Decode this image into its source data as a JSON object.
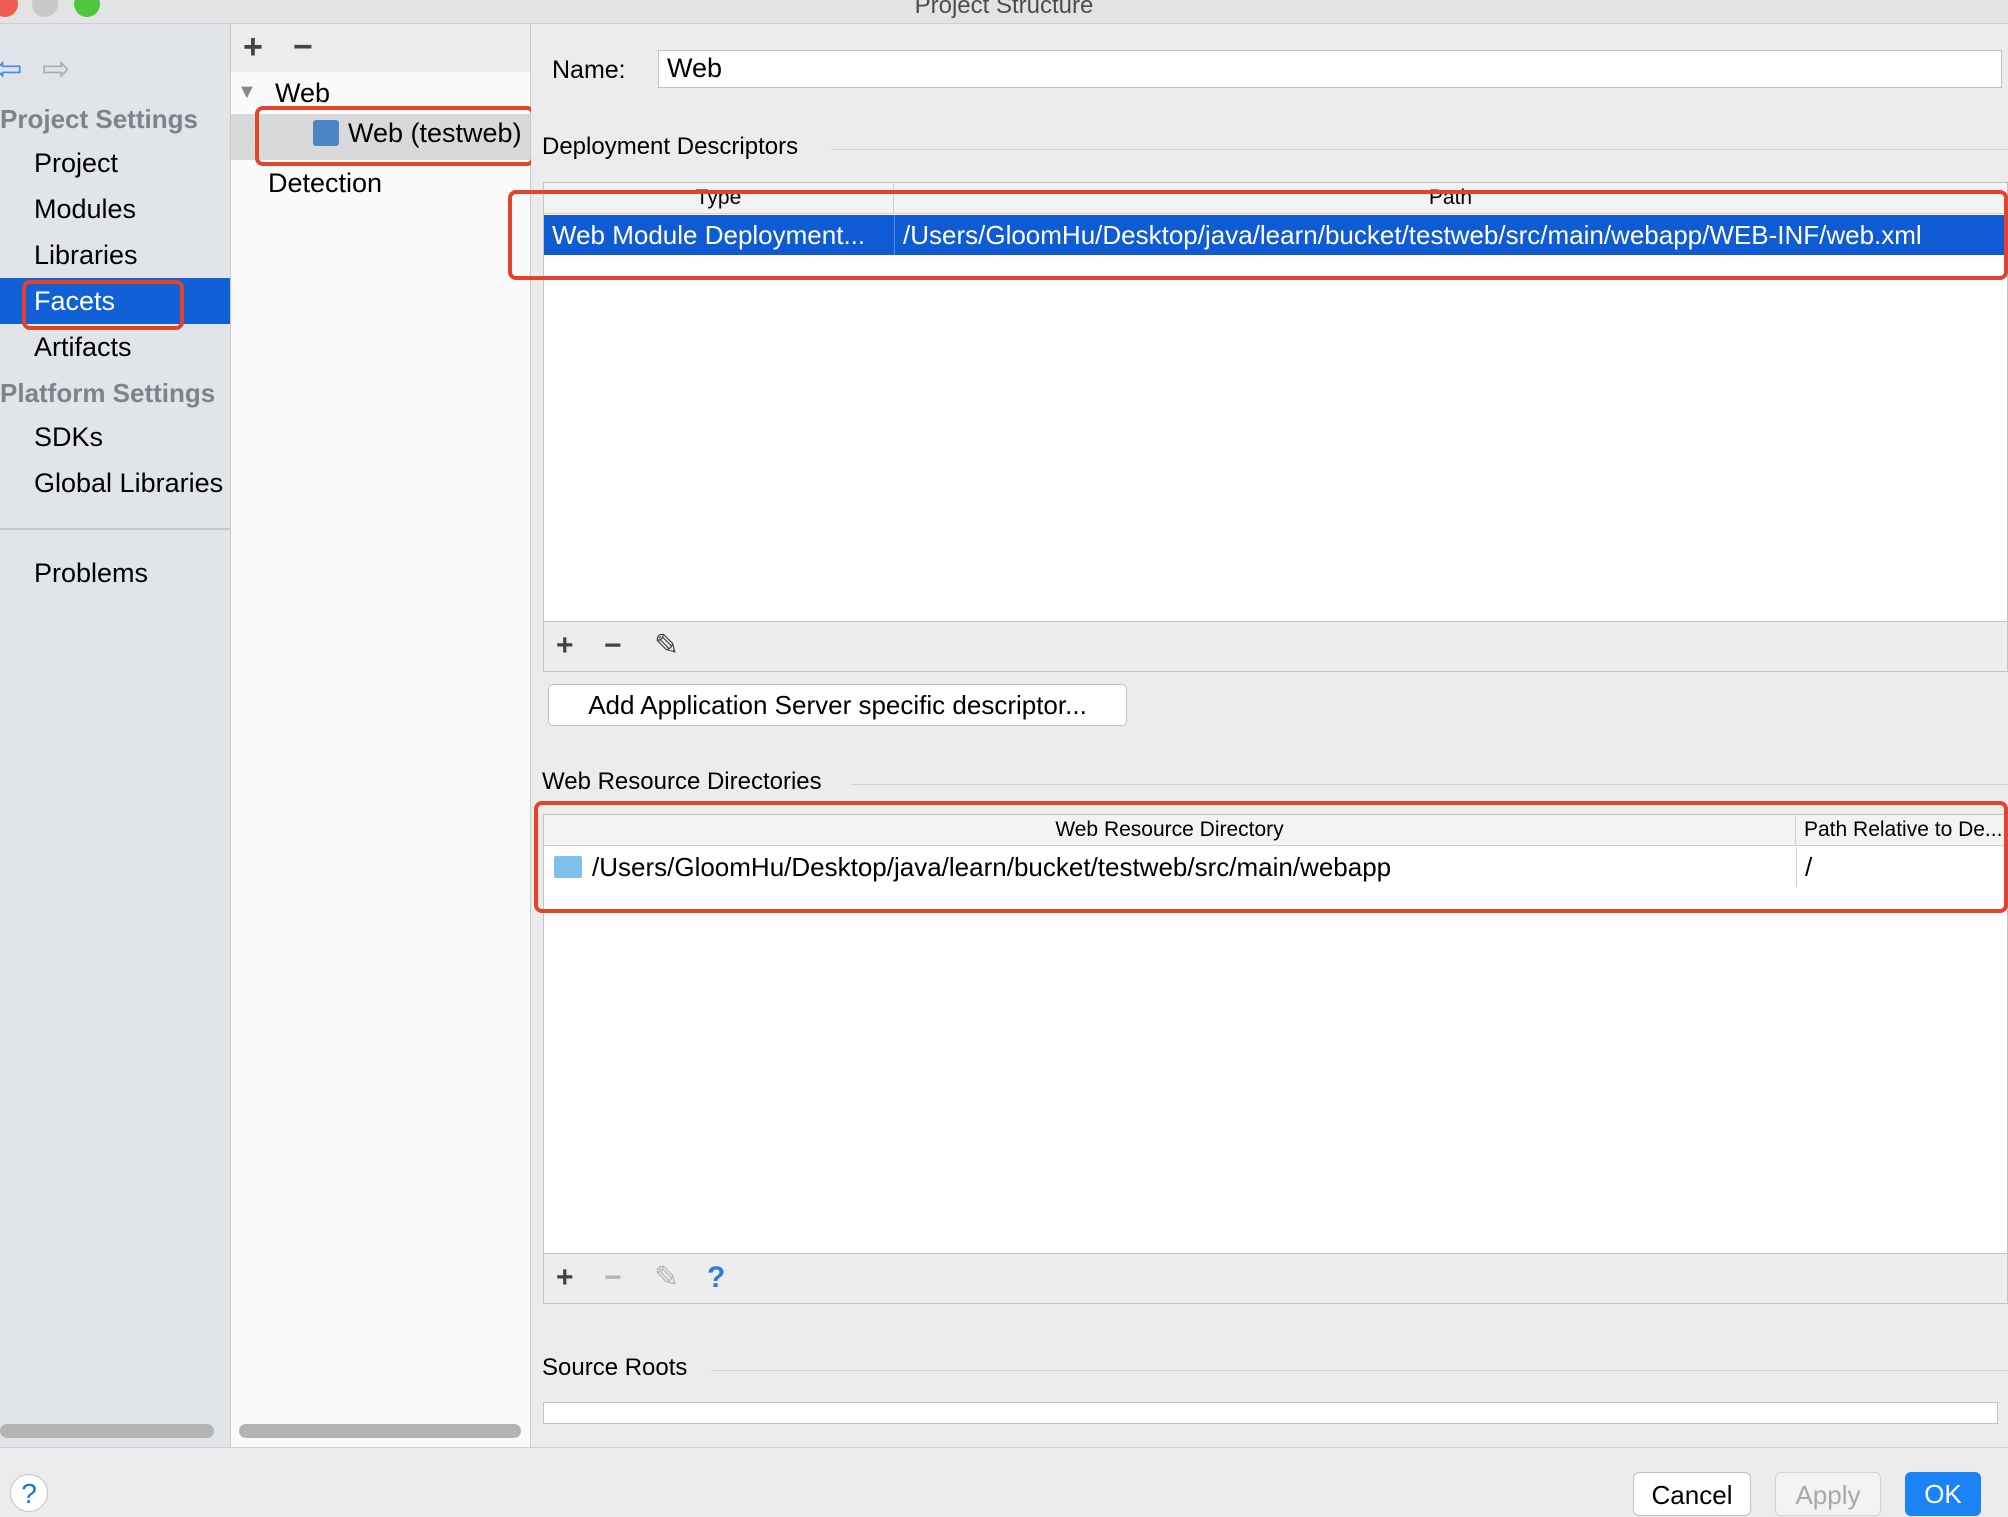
{
  "window": {
    "title": "Project Structure"
  },
  "sidebar": {
    "project_settings_label": "Project Settings",
    "project_items": [
      "Project",
      "Modules",
      "Libraries",
      "Facets",
      "Artifacts"
    ],
    "platform_settings_label": "Platform Settings",
    "platform_items": [
      "SDKs",
      "Global Libraries"
    ],
    "problems_label": "Problems",
    "selected": "Facets"
  },
  "tree": {
    "add_label": "+",
    "remove_label": "−",
    "group_label": "Web",
    "facet_label": "Web (testweb)",
    "detection_label": "Detection"
  },
  "main": {
    "name_label": "Name:",
    "name_value": "Web",
    "deployment": {
      "title": "Deployment Descriptors",
      "columns": [
        "Type",
        "Path"
      ],
      "rows": [
        {
          "type": "Web Module Deployment...",
          "path": "/Users/GloomHu/Desktop/java/learn/bucket/testweb/src/main/webapp/WEB-INF/web.xml"
        }
      ],
      "add_button": "Add Application Server specific descriptor..."
    },
    "resources": {
      "title": "Web Resource Directories",
      "columns": [
        "Web Resource Directory",
        "Path Relative to De..."
      ],
      "rows": [
        {
          "directory": "/Users/GloomHu/Desktop/java/learn/bucket/testweb/src/main/webapp",
          "relative": "/"
        }
      ],
      "help_label": "?"
    },
    "source_roots": {
      "title": "Source Roots"
    }
  },
  "footer": {
    "help": "?",
    "cancel": "Cancel",
    "apply": "Apply",
    "ok": "OK"
  },
  "colors": {
    "selection": "#1160d8",
    "highlight": "#e2432a",
    "primary_button": "#1a84f7"
  }
}
